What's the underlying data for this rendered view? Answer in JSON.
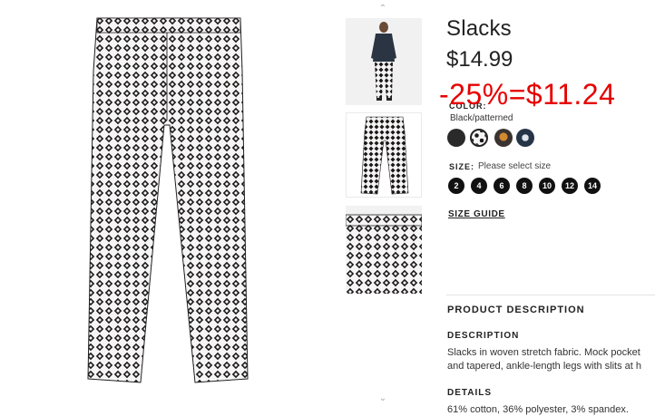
{
  "product": {
    "title": "Slacks",
    "price": "$14.99",
    "discount_text": "-25%=$11.24",
    "color": {
      "label": "COLOR:",
      "value": "Black/patterned",
      "swatches": [
        "black",
        "black-white-pattern",
        "orange-pattern",
        "navy-pattern"
      ]
    },
    "size": {
      "label": "SIZE:",
      "hint": "Please select size",
      "options": [
        "2",
        "4",
        "6",
        "8",
        "10",
        "12",
        "14"
      ]
    },
    "size_guide": "SIZE GUIDE"
  },
  "description": {
    "section_heading": "PRODUCT DESCRIPTION",
    "heading": "DESCRIPTION",
    "line1": "Slacks in woven stretch fabric. Mock pocket",
    "line2": "and tapered, ankle-length legs with slits at h",
    "details_heading": "DETAILS",
    "details": "61% cotton, 36% polyester, 3% spandex."
  },
  "gallery": {
    "up_arrow": "⌃",
    "down_arrow": "⌄",
    "icons": [
      "chevron-up-icon",
      "chevron-down-icon"
    ]
  },
  "colors": {
    "discount_red": "#e60000",
    "text": "#222222",
    "size_button": "#111111"
  }
}
